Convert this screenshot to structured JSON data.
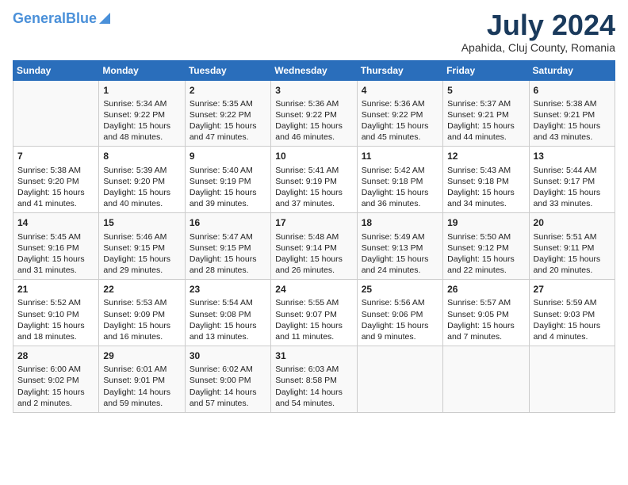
{
  "header": {
    "logo_line1": "General",
    "logo_line2": "Blue",
    "month_year": "July 2024",
    "location": "Apahida, Cluj County, Romania"
  },
  "days_of_week": [
    "Sunday",
    "Monday",
    "Tuesday",
    "Wednesday",
    "Thursday",
    "Friday",
    "Saturday"
  ],
  "weeks": [
    [
      {
        "day": "",
        "content": ""
      },
      {
        "day": "1",
        "content": "Sunrise: 5:34 AM\nSunset: 9:22 PM\nDaylight: 15 hours\nand 48 minutes."
      },
      {
        "day": "2",
        "content": "Sunrise: 5:35 AM\nSunset: 9:22 PM\nDaylight: 15 hours\nand 47 minutes."
      },
      {
        "day": "3",
        "content": "Sunrise: 5:36 AM\nSunset: 9:22 PM\nDaylight: 15 hours\nand 46 minutes."
      },
      {
        "day": "4",
        "content": "Sunrise: 5:36 AM\nSunset: 9:22 PM\nDaylight: 15 hours\nand 45 minutes."
      },
      {
        "day": "5",
        "content": "Sunrise: 5:37 AM\nSunset: 9:21 PM\nDaylight: 15 hours\nand 44 minutes."
      },
      {
        "day": "6",
        "content": "Sunrise: 5:38 AM\nSunset: 9:21 PM\nDaylight: 15 hours\nand 43 minutes."
      }
    ],
    [
      {
        "day": "7",
        "content": "Sunrise: 5:38 AM\nSunset: 9:20 PM\nDaylight: 15 hours\nand 41 minutes."
      },
      {
        "day": "8",
        "content": "Sunrise: 5:39 AM\nSunset: 9:20 PM\nDaylight: 15 hours\nand 40 minutes."
      },
      {
        "day": "9",
        "content": "Sunrise: 5:40 AM\nSunset: 9:19 PM\nDaylight: 15 hours\nand 39 minutes."
      },
      {
        "day": "10",
        "content": "Sunrise: 5:41 AM\nSunset: 9:19 PM\nDaylight: 15 hours\nand 37 minutes."
      },
      {
        "day": "11",
        "content": "Sunrise: 5:42 AM\nSunset: 9:18 PM\nDaylight: 15 hours\nand 36 minutes."
      },
      {
        "day": "12",
        "content": "Sunrise: 5:43 AM\nSunset: 9:18 PM\nDaylight: 15 hours\nand 34 minutes."
      },
      {
        "day": "13",
        "content": "Sunrise: 5:44 AM\nSunset: 9:17 PM\nDaylight: 15 hours\nand 33 minutes."
      }
    ],
    [
      {
        "day": "14",
        "content": "Sunrise: 5:45 AM\nSunset: 9:16 PM\nDaylight: 15 hours\nand 31 minutes."
      },
      {
        "day": "15",
        "content": "Sunrise: 5:46 AM\nSunset: 9:15 PM\nDaylight: 15 hours\nand 29 minutes."
      },
      {
        "day": "16",
        "content": "Sunrise: 5:47 AM\nSunset: 9:15 PM\nDaylight: 15 hours\nand 28 minutes."
      },
      {
        "day": "17",
        "content": "Sunrise: 5:48 AM\nSunset: 9:14 PM\nDaylight: 15 hours\nand 26 minutes."
      },
      {
        "day": "18",
        "content": "Sunrise: 5:49 AM\nSunset: 9:13 PM\nDaylight: 15 hours\nand 24 minutes."
      },
      {
        "day": "19",
        "content": "Sunrise: 5:50 AM\nSunset: 9:12 PM\nDaylight: 15 hours\nand 22 minutes."
      },
      {
        "day": "20",
        "content": "Sunrise: 5:51 AM\nSunset: 9:11 PM\nDaylight: 15 hours\nand 20 minutes."
      }
    ],
    [
      {
        "day": "21",
        "content": "Sunrise: 5:52 AM\nSunset: 9:10 PM\nDaylight: 15 hours\nand 18 minutes."
      },
      {
        "day": "22",
        "content": "Sunrise: 5:53 AM\nSunset: 9:09 PM\nDaylight: 15 hours\nand 16 minutes."
      },
      {
        "day": "23",
        "content": "Sunrise: 5:54 AM\nSunset: 9:08 PM\nDaylight: 15 hours\nand 13 minutes."
      },
      {
        "day": "24",
        "content": "Sunrise: 5:55 AM\nSunset: 9:07 PM\nDaylight: 15 hours\nand 11 minutes."
      },
      {
        "day": "25",
        "content": "Sunrise: 5:56 AM\nSunset: 9:06 PM\nDaylight: 15 hours\nand 9 minutes."
      },
      {
        "day": "26",
        "content": "Sunrise: 5:57 AM\nSunset: 9:05 PM\nDaylight: 15 hours\nand 7 minutes."
      },
      {
        "day": "27",
        "content": "Sunrise: 5:59 AM\nSunset: 9:03 PM\nDaylight: 15 hours\nand 4 minutes."
      }
    ],
    [
      {
        "day": "28",
        "content": "Sunrise: 6:00 AM\nSunset: 9:02 PM\nDaylight: 15 hours\nand 2 minutes."
      },
      {
        "day": "29",
        "content": "Sunrise: 6:01 AM\nSunset: 9:01 PM\nDaylight: 14 hours\nand 59 minutes."
      },
      {
        "day": "30",
        "content": "Sunrise: 6:02 AM\nSunset: 9:00 PM\nDaylight: 14 hours\nand 57 minutes."
      },
      {
        "day": "31",
        "content": "Sunrise: 6:03 AM\nSunset: 8:58 PM\nDaylight: 14 hours\nand 54 minutes."
      },
      {
        "day": "",
        "content": ""
      },
      {
        "day": "",
        "content": ""
      },
      {
        "day": "",
        "content": ""
      }
    ]
  ]
}
